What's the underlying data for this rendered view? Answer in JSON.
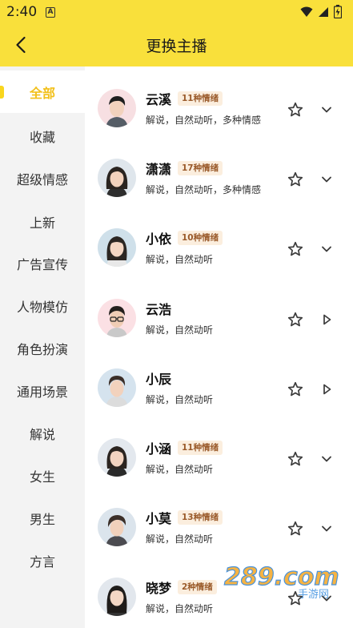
{
  "status": {
    "time": "2:40"
  },
  "header": {
    "title": "更换主播"
  },
  "sidebar": {
    "items": [
      {
        "label": "全部",
        "active": true
      },
      {
        "label": "收藏"
      },
      {
        "label": "超级情感"
      },
      {
        "label": "上新"
      },
      {
        "label": "广告宣传"
      },
      {
        "label": "人物模仿"
      },
      {
        "label": "角色扮演"
      },
      {
        "label": "通用场景"
      },
      {
        "label": "解说"
      },
      {
        "label": "女生"
      },
      {
        "label": "男生"
      },
      {
        "label": "方言"
      }
    ]
  },
  "anchors": [
    {
      "name": "云溪",
      "badge": "11种情绪",
      "desc": "解说，自然动听，多种情感",
      "action": "expand"
    },
    {
      "name": "潇潇",
      "badge": "17种情绪",
      "desc": "解说，自然动听，多种情感",
      "action": "expand"
    },
    {
      "name": "小依",
      "badge": "10种情绪",
      "desc": "解说，自然动听",
      "action": "expand"
    },
    {
      "name": "云浩",
      "badge": "",
      "desc": "解说，自然动听",
      "action": "play"
    },
    {
      "name": "小辰",
      "badge": "",
      "desc": "解说，自然动听",
      "action": "play"
    },
    {
      "name": "小涵",
      "badge": "11种情绪",
      "desc": "解说，自然动听",
      "action": "expand"
    },
    {
      "name": "小莫",
      "badge": "13种情绪",
      "desc": "解说，自然动听",
      "action": "expand"
    },
    {
      "name": "晓梦",
      "badge": "2种情绪",
      "desc": "解说，自然动听",
      "action": "expand"
    }
  ],
  "watermark": {
    "text": "289.com",
    "sub": "手游网"
  },
  "colors": {
    "accent": "#f9e03b",
    "active_text": "#f2c01a",
    "badge_bg": "#fbeede",
    "badge_text": "#9a5a2a"
  }
}
